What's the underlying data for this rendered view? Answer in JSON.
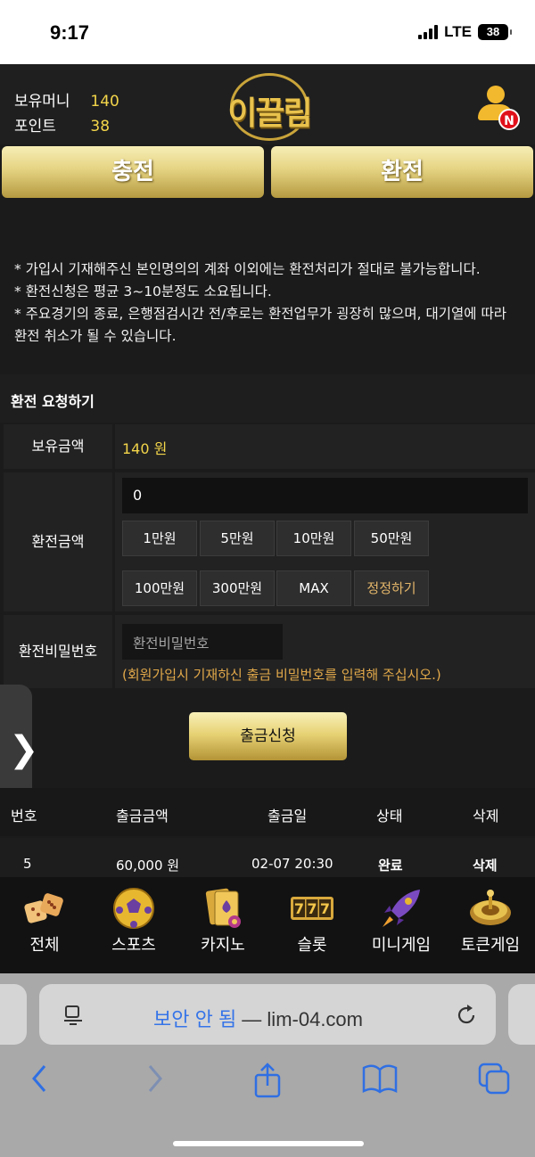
{
  "status_bar": {
    "time": "9:17",
    "network": "LTE",
    "battery": "38"
  },
  "header": {
    "money_label": "보유머니",
    "money_value": "140",
    "point_label": "포인트",
    "point_value": "38",
    "logo_text": "이끌림",
    "badge": "N"
  },
  "tabs": {
    "charge": "충전",
    "exchange": "환전"
  },
  "notices": [
    "* 가입시 기재해주신 본인명의의 계좌 이외에는 환전처리가 절대로 불가능합니다.",
    "* 환전신청은 평균 3~10분정도 소요됩니다.",
    "* 주요경기의 종료, 은행점검시간 전/후로는 환전업무가 굉장히 많으며, 대기열에 따라 환전 취소가 될 수 있습니다."
  ],
  "form": {
    "title": "환전 요청하기",
    "balance_label": "보유금액",
    "balance_value": "140 원",
    "amount_label": "환전금액",
    "amount_value": "0",
    "chips": [
      "1만원",
      "5만원",
      "10만원",
      "50만원",
      "100만원",
      "300만원",
      "MAX",
      "정정하기"
    ],
    "password_label": "환전비밀번호",
    "password_placeholder": "환전비밀번호",
    "password_hint": "(회원가입시 기재하신 출금 비밀번호를 입력해 주십시오.)",
    "submit": "출금신청"
  },
  "history": {
    "headers": [
      "번호",
      "출금금액",
      "출금일",
      "상태",
      "삭제"
    ],
    "rows": [
      {
        "no": "5",
        "amount": "60,000 원",
        "date": "02-07 20:30",
        "status": "완료",
        "delete": "삭제"
      }
    ]
  },
  "game_nav": [
    {
      "label": "전체",
      "icon": "dice-icon"
    },
    {
      "label": "스포츠",
      "icon": "soccer-ball-icon"
    },
    {
      "label": "카지노",
      "icon": "playing-cards-icon"
    },
    {
      "label": "슬롯",
      "icon": "slot-777-icon"
    },
    {
      "label": "미니게임",
      "icon": "rocket-icon"
    },
    {
      "label": "토큰게임",
      "icon": "roulette-icon"
    }
  ],
  "browser": {
    "security_text": "보안 안 됨",
    "separator": " — ",
    "domain": "lim-04.com"
  },
  "colors": {
    "gold": "#e5d382",
    "accent_yellow": "#f3d54a",
    "hint_orange": "#e2a94a",
    "link_blue": "#2f6fe3"
  }
}
